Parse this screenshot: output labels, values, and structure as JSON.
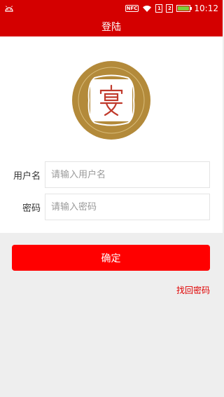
{
  "status_bar": {
    "nfc_label": "NFC",
    "sim1_label": "1",
    "sim2_label": "2",
    "battery_level": 1.0,
    "battery_color": "#7ccc3a",
    "time": "10:12"
  },
  "header": {
    "title": "登陆"
  },
  "logo": {
    "glyph": "宴",
    "ring_color": "#b38a3a",
    "glyph_color": "#c0392b"
  },
  "form": {
    "username_label": "用户名",
    "username_placeholder": "请输入用户名",
    "username_value": "",
    "password_label": "密码",
    "password_placeholder": "请输入密码",
    "password_value": ""
  },
  "actions": {
    "confirm_label": "确定",
    "forgot_password_label": "找回密码"
  },
  "colors": {
    "brand_red": "#d40000",
    "button_red": "#ff0000"
  }
}
